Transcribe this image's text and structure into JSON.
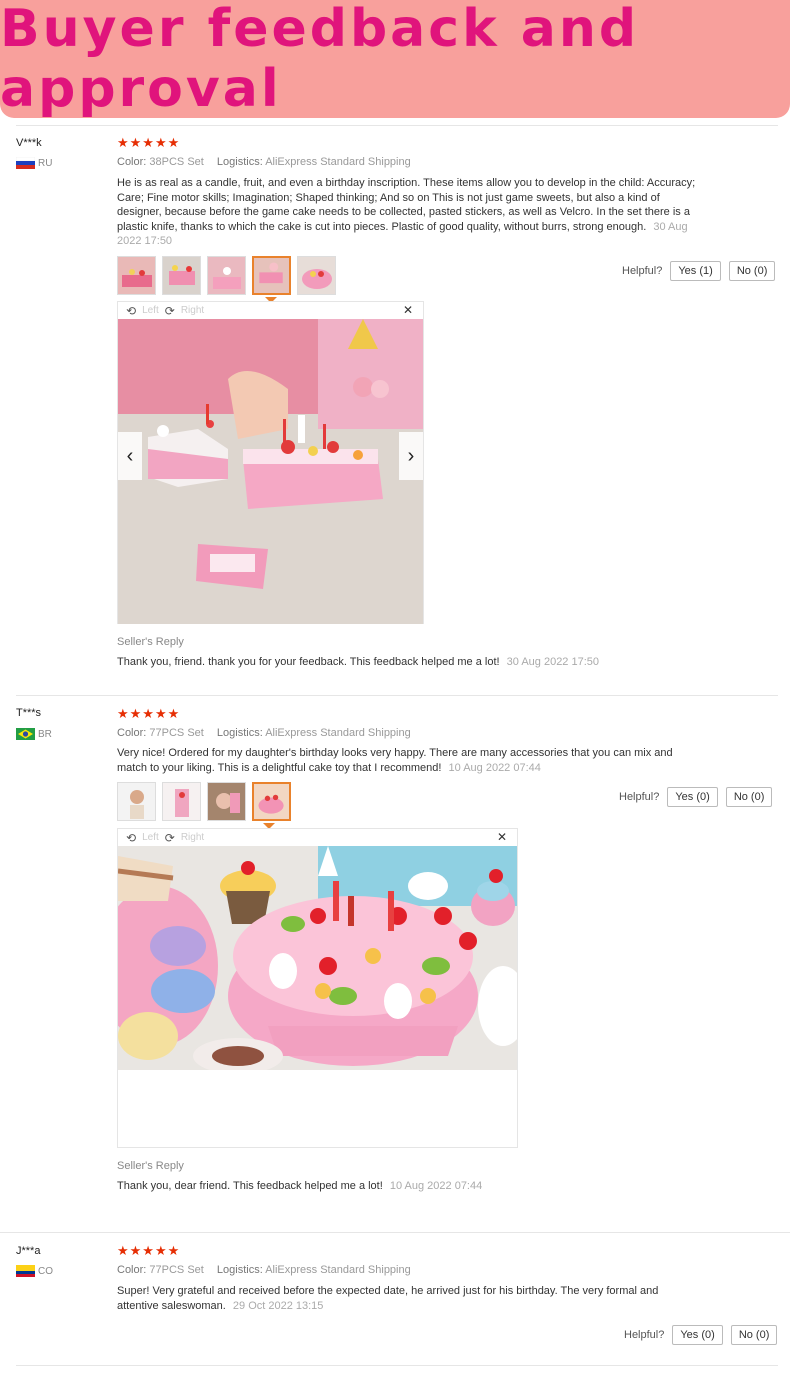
{
  "banner": {
    "title": "Buyer feedback and approval"
  },
  "labels": {
    "color": "Color:",
    "logistics": "Logistics:",
    "helpful": "Helpful?",
    "seller_reply": "Seller's Reply",
    "rotate_left": "Left",
    "rotate_right": "Right",
    "stars": "★★★★★"
  },
  "reviews": [
    {
      "user": "V***k",
      "country": "RU",
      "color": "38PCS Set",
      "logistics": "AliExpress Standard Shipping",
      "text": "He is as real as a candle, fruit, and even a birthday inscription. These items allow you to develop in the child: Accuracy; Care; Fine motor skills; Imagination; Shaped thinking; And so on This is not just game sweets, but also a kind of designer, because before the game cake needs to be collected, pasted stickers, as well as Velcro. In the set there is a plastic knife, thanks to which the cake is cut into pieces. Plastic of good quality, without burrs, strong enough.",
      "date": "30 Aug 2022 17:50",
      "yes": "Yes (1)",
      "no": "No (0)",
      "reply": "Thank you, friend. thank you for your feedback. This feedback helped me a lot!",
      "reply_date": "30 Aug 2022 17:50"
    },
    {
      "user": "T***s",
      "country": "BR",
      "color": "77PCS Set",
      "logistics": "AliExpress Standard Shipping",
      "text": "Very nice! Ordered for my daughter's birthday looks very happy. There are many accessories that you can mix and match to your liking. This is a delightful cake toy that I recommend!",
      "date": "10 Aug 2022 07:44",
      "yes": "Yes (0)",
      "no": "No (0)",
      "reply": "Thank you, dear friend. This feedback helped me a lot!",
      "reply_date": "10 Aug 2022 07:44"
    },
    {
      "user": "J***a",
      "country": "CO",
      "color": "77PCS Set",
      "logistics": "AliExpress Standard Shipping",
      "text": "Super! Very grateful and received before the expected date, he arrived just for his birthday. The very formal and attentive saleswoman.",
      "date": "29 Oct 2022 13:15",
      "yes": "Yes (0)",
      "no": "No (0)"
    }
  ],
  "colors": {
    "banner_bg": "#f8a09c",
    "banner_text": "#e0147c",
    "stars": "#e62e04",
    "active_thumb": "#e9822c"
  }
}
